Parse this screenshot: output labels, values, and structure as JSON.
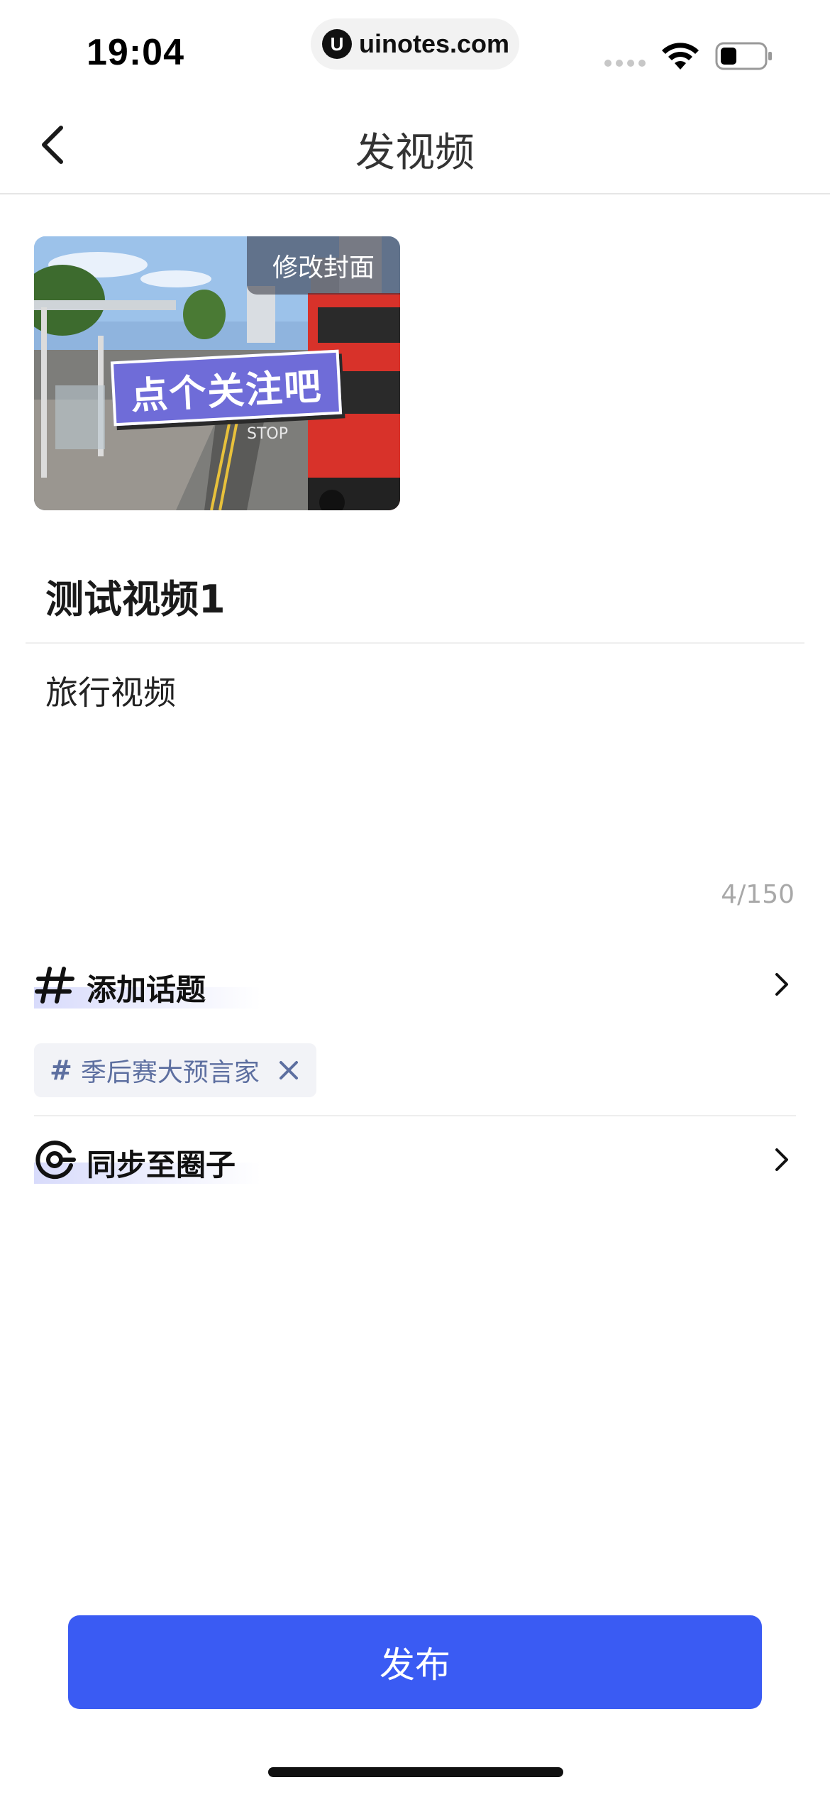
{
  "status_bar": {
    "time": "19:04",
    "url": "uinotes.com",
    "url_logo_letter": "U"
  },
  "nav": {
    "title": "发视频",
    "back_icon": "chevron-left-icon"
  },
  "cover": {
    "edit_label": "修改封面",
    "sticker_text": "点个关注吧"
  },
  "form": {
    "title_value": "测试视频1",
    "description_value": "旅行视频",
    "char_counter": "4/150"
  },
  "topic_row": {
    "icon": "hash-icon",
    "label": "添加话题",
    "chevron": "chevron-right-icon"
  },
  "topic_tag": {
    "hash": "#",
    "label": "季后赛大预言家",
    "close_icon": "close-icon"
  },
  "circle_row": {
    "icon": "circle-sync-icon",
    "label": "同步至圈子",
    "chevron": "chevron-right-icon"
  },
  "publish": {
    "label": "发布"
  },
  "colors": {
    "accent": "#3a5bf3",
    "tag_bg": "#f2f3f7",
    "tag_text": "#5d6fa0",
    "highlight": "#d8dbfb",
    "counter": "#a8a8a8"
  }
}
